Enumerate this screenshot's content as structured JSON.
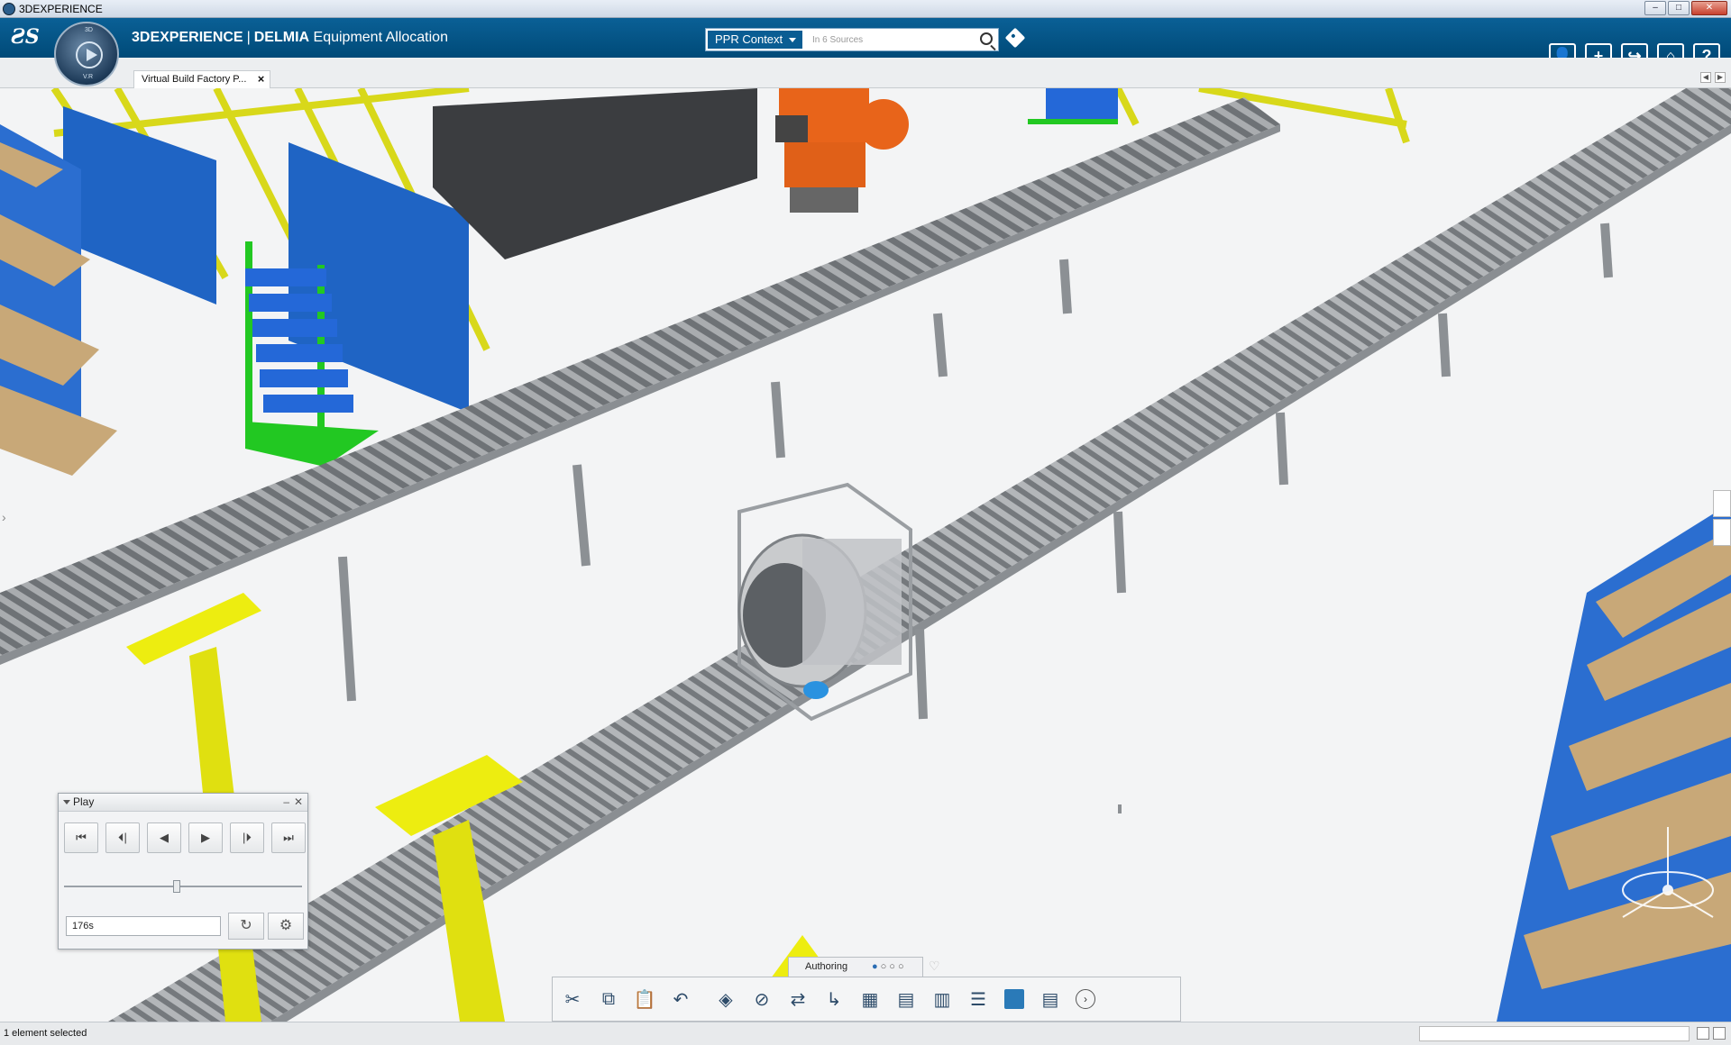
{
  "window": {
    "title": "3DEXPERIENCE"
  },
  "app": {
    "brand_prefix": "3DEXPERIENCE",
    "brand_separator": "|",
    "brand_product": "DELMIA",
    "brand_app": "Equipment Allocation",
    "compass_top": "3D",
    "compass_bottom": "V.R"
  },
  "search": {
    "context_label": "PPR Context",
    "placeholder": "In 6 Sources"
  },
  "tabs": [
    {
      "label": "Virtual Build Factory P..."
    }
  ],
  "play_panel": {
    "title": "Play",
    "time_value": "176s",
    "slider_fraction": 0.46,
    "controls": [
      "first-frame",
      "previous-frame",
      "play-backward",
      "play-forward",
      "next-frame",
      "last-frame"
    ]
  },
  "actionbar": {
    "active_section": "Authoring",
    "section_dots": 4,
    "active_dot": 0
  },
  "status": {
    "text": "1 element selected"
  },
  "colors": {
    "topbar_blue": "#005386",
    "safety_yellow": "#e8e820",
    "panel_blue": "#1e63c8",
    "robot_orange": "#e8641a",
    "rack_green": "#22c822",
    "shelf_tan": "#c8a878"
  }
}
